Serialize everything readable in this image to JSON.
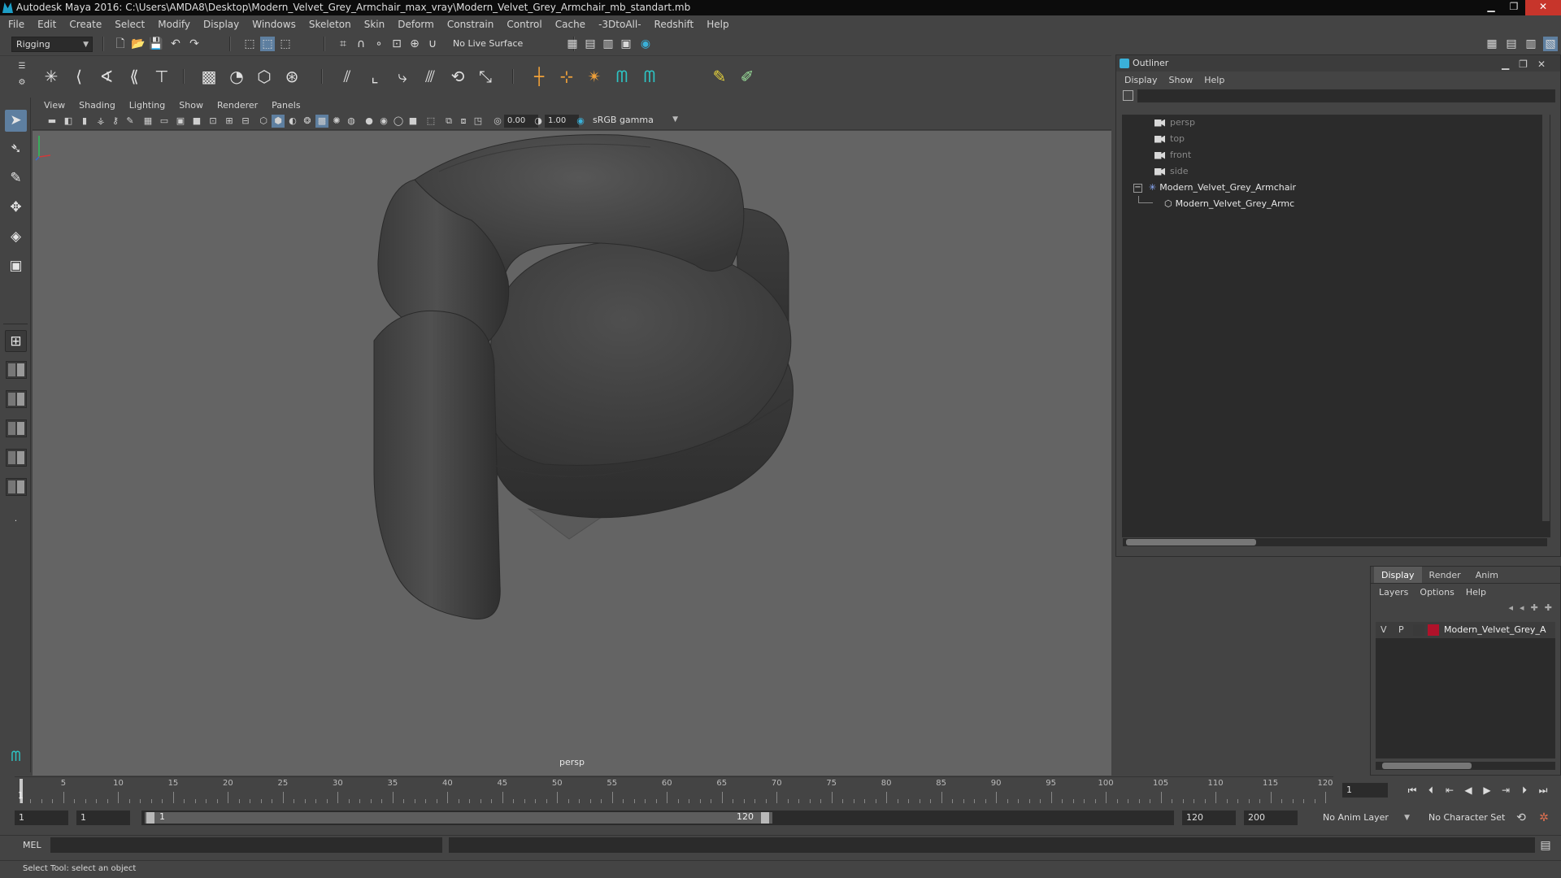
{
  "titlebar": {
    "title": "Autodesk Maya 2016: C:\\Users\\AMDA8\\Desktop\\Modern_Velvet_Grey_Armchair_max_vray\\Modern_Velvet_Grey_Armchair_mb_standart.mb",
    "minimize": "▁",
    "maximize": "❐",
    "close": "✕"
  },
  "menubar": [
    "File",
    "Edit",
    "Create",
    "Select",
    "Modify",
    "Display",
    "Windows",
    "Skeleton",
    "Skin",
    "Deform",
    "Constrain",
    "Control",
    "Cache",
    "-3DtoAll-",
    "Redshift",
    "Help"
  ],
  "statusline": {
    "menuset": "Rigging",
    "live_surface": "No Live Surface"
  },
  "viewport": {
    "menu": [
      "View",
      "Shading",
      "Lighting",
      "Show",
      "Renderer",
      "Panels"
    ],
    "exposure": "0.00",
    "gamma": "1.00",
    "color_space": "sRGB gamma",
    "camera_label": "persp"
  },
  "outliner": {
    "title": "Outliner",
    "menu": [
      "Display",
      "Show",
      "Help"
    ],
    "items": [
      {
        "label": "persp",
        "kind": "camera",
        "dim": true
      },
      {
        "label": "top",
        "kind": "camera",
        "dim": true
      },
      {
        "label": "front",
        "kind": "camera",
        "dim": true
      },
      {
        "label": "side",
        "kind": "camera",
        "dim": true
      },
      {
        "label": "Modern_Velvet_Grey_Armchair",
        "kind": "group",
        "dim": false
      },
      {
        "label": "Modern_Velvet_Grey_Armc",
        "kind": "mesh",
        "dim": false
      }
    ]
  },
  "layer_editor": {
    "tabs": [
      "Display",
      "Render",
      "Anim"
    ],
    "active_tab": "Display",
    "menu": [
      "Layers",
      "Options",
      "Help"
    ],
    "layer": {
      "visible": "V",
      "playback": "P",
      "name": "Modern_Velvet_Grey_A",
      "color": "#b0122a"
    }
  },
  "timeline": {
    "ticks": [
      "5",
      "10",
      "15",
      "20",
      "25",
      "30",
      "35",
      "40",
      "45",
      "50",
      "55",
      "60",
      "65",
      "70",
      "75",
      "80",
      "85",
      "90",
      "95",
      "100",
      "105",
      "110",
      "115",
      "120"
    ],
    "start_label": "1",
    "current_frame": "1"
  },
  "range": {
    "start_time": "1",
    "playback_start": "1",
    "range_start_label": "1",
    "range_end_label": "120",
    "playback_end": "120",
    "end_time": "200",
    "anim_layer": "No Anim Layer",
    "character_set": "No Character Set"
  },
  "cmdline": {
    "label": "MEL"
  },
  "helpline": {
    "text": "Select Tool: select an object"
  },
  "colors": {
    "accent": "#5e7fa0",
    "viewport_bg": "#646464",
    "panel_bg": "#444444",
    "field_bg": "#2b2b2b"
  }
}
